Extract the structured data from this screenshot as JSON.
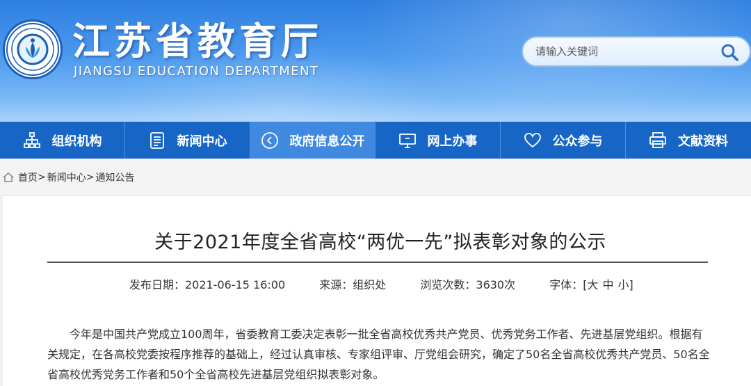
{
  "header": {
    "title": "江苏省教育厅",
    "subtitle": "JIANGSU EDUCATION DEPARTMENT",
    "logo_icon": "emblem-icon"
  },
  "search": {
    "placeholder": "请输入关键词",
    "icon": "search-icon"
  },
  "nav": {
    "items": [
      {
        "label": "组织机构",
        "icon": "org-chart-icon"
      },
      {
        "label": "新闻中心",
        "icon": "document-icon"
      },
      {
        "label": "政府信息公开",
        "icon": "play-circle-icon"
      },
      {
        "label": "网上办事",
        "icon": "monitor-icon"
      },
      {
        "label": "公众参与",
        "icon": "heart-icon"
      },
      {
        "label": "文献资料",
        "icon": "printer-icon"
      }
    ],
    "active_index": 2
  },
  "breadcrumb": {
    "items": [
      "首页",
      "新闻中心",
      "通知公告"
    ],
    "separator": ">"
  },
  "article": {
    "title": "关于2021年度全省高校“两优一先”拟表彰对象的公示",
    "meta": {
      "date": "发布日期：2021-06-15 16:00",
      "source": "来源：组织处",
      "views": "浏览次数：3630次",
      "font_label": "字体：",
      "font_open": "[",
      "font_large": "大",
      "font_medium": "中",
      "font_small": "小",
      "font_close": "]"
    },
    "body": "今年是中国共产党成立100周年，省委教育工委决定表彰一批全省高校优秀共产党员、优秀党务工作者、先进基层党组织。根据有关规定，在各高校党委按程序推荐的基础上，经过认真审核、专家组评审、厅党组会研究，确定了50名全省高校优秀共产党员、50名全省高校优秀党务工作者和50个全省高校先进基层党组织拟表彰对象。"
  },
  "colors": {
    "header_top": "#2f7fe0",
    "nav_bg": "#1766c6",
    "nav_active": "#3f89e0",
    "breadcrumb_bg": "#f3f3f3"
  }
}
